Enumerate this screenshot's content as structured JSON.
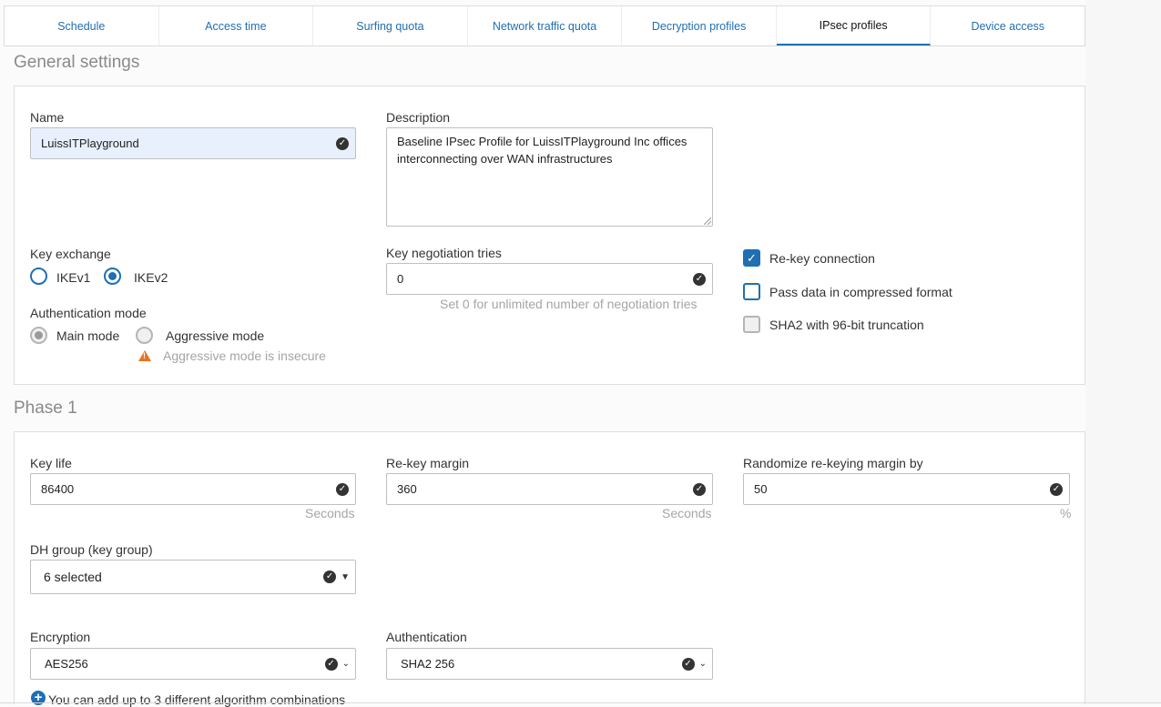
{
  "tabs": [
    {
      "label": "Schedule",
      "active": false
    },
    {
      "label": "Access time",
      "active": false
    },
    {
      "label": "Surfing quota",
      "active": false
    },
    {
      "label": "Network traffic quota",
      "active": false
    },
    {
      "label": "Decryption profiles",
      "active": false
    },
    {
      "label": "IPsec profiles",
      "active": true
    },
    {
      "label": "Device access",
      "active": false
    }
  ],
  "general": {
    "title": "General settings",
    "name_label": "Name",
    "name_value": "LuissITPlayground",
    "description_label": "Description",
    "description_value": "Baseline IPsec Profile for LuissITPlayground Inc offices interconnecting over WAN infrastructures",
    "key_exchange_label": "Key exchange",
    "key_exchange_options": [
      "IKEv1",
      "IKEv2"
    ],
    "key_exchange_selected": "IKEv2",
    "auth_mode_label": "Authentication mode",
    "auth_mode_options": [
      "Main mode",
      "Aggressive mode"
    ],
    "auth_mode_selected": "Main mode",
    "auth_mode_warning": "Aggressive mode is insecure",
    "negotiation_label": "Key negotiation tries",
    "negotiation_value": "0",
    "negotiation_hint": "Set 0 for unlimited number of negotiation tries",
    "options": [
      {
        "label": "Re-key connection",
        "checked": true
      },
      {
        "label": "Pass data in compressed format",
        "checked": false
      },
      {
        "label": "SHA2 with 96-bit truncation",
        "checked": false
      }
    ]
  },
  "phase1": {
    "title": "Phase 1",
    "key_life_label": "Key life",
    "key_life_value": "86400",
    "key_life_unit": "Seconds",
    "rekey_margin_label": "Re-key margin",
    "rekey_margin_value": "360",
    "rekey_margin_unit": "Seconds",
    "randomize_label": "Randomize re-keying margin by",
    "randomize_value": "50",
    "randomize_unit": "%",
    "dh_group_label": "DH group (key group)",
    "dh_group_value": "6 selected",
    "encryption_label": "Encryption",
    "encryption_value": "AES256",
    "authentication_label": "Authentication",
    "authentication_value": "SHA2 256",
    "add_combination_text": "You can add up to 3 different algorithm combinations"
  },
  "colors": {
    "accent": "#1f6fb2",
    "warning": "#e8731e",
    "highlight_field": "#e8f0fd"
  }
}
